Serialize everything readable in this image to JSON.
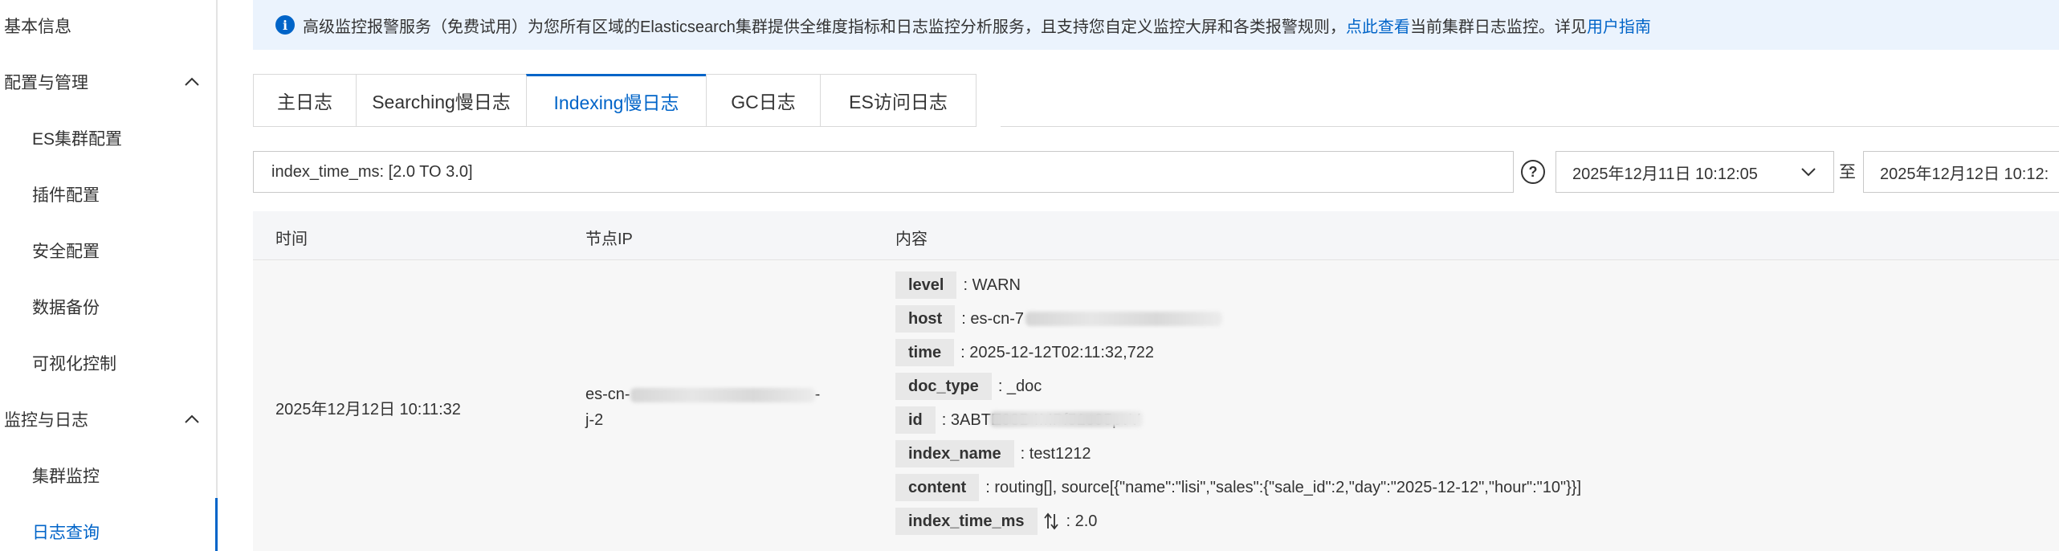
{
  "sidebar": {
    "items": [
      {
        "label": "基本信息"
      },
      {
        "label": "配置与管理"
      },
      {
        "label": "ES集群配置"
      },
      {
        "label": "插件配置"
      },
      {
        "label": "安全配置"
      },
      {
        "label": "数据备份"
      },
      {
        "label": "可视化控制"
      },
      {
        "label": "监控与日志"
      },
      {
        "label": "集群监控"
      },
      {
        "label": "日志查询"
      }
    ]
  },
  "notice": {
    "text": "高级监控报警服务（免费试用）为您所有区域的Elasticsearch集群提供全维度指标和日志监控分析服务，且支持您自定义监控大屏和各类报警规则，",
    "link1": "点此查看",
    "mid": "当前集群日志监控。详见",
    "link2": "用户指南"
  },
  "tabs": [
    {
      "label": "主日志"
    },
    {
      "label": "Searching慢日志"
    },
    {
      "label": "Indexing慢日志"
    },
    {
      "label": "GC日志"
    },
    {
      "label": "ES访问日志"
    }
  ],
  "filter": {
    "query": "index_time_ms: [2.0 TO 3.0]",
    "date_start": "2025年12月11日 10:12:05",
    "separator": "至",
    "date_end": "2025年12月12日 10:12:"
  },
  "table": {
    "headers": [
      "时间",
      "节点IP",
      "内容"
    ],
    "row": {
      "time": "2025年12月12日 10:11:32",
      "ip_line1": "es-cn-",
      "ip_line1_end": "-",
      "ip_line2": "j-2",
      "content": [
        {
          "key": "level",
          "value": ": WARN"
        },
        {
          "key": "host",
          "value": ": es-cn-7"
        },
        {
          "key": "time",
          "value": ": 2025-12-12T02:11:32,722"
        },
        {
          "key": "doc_type",
          "value": ": _doc"
        },
        {
          "key": "id",
          "value": ": 3ABTE93B4MPf51e95pvV"
        },
        {
          "key": "index_name",
          "value": ": test1212"
        },
        {
          "key": "content",
          "value": ": routing[], source[{\"name\":\"lisi\",\"sales\":{\"sale_id\":2,\"day\":\"2025-12-12\",\"hour\":\"10\"}}]"
        },
        {
          "key": "index_time_ms",
          "value": ": 2.0"
        }
      ]
    }
  },
  "colors": {
    "accent": "#0064c8",
    "notice_bg": "#ebf3fd",
    "header_bg": "#f5f6f8",
    "row_bg": "#f7f7f7",
    "key_bg": "#e8e8e8"
  },
  "icons": [
    "info-icon",
    "chevron-up-icon",
    "help-icon",
    "chevron-down-icon",
    "sort-icon"
  ]
}
